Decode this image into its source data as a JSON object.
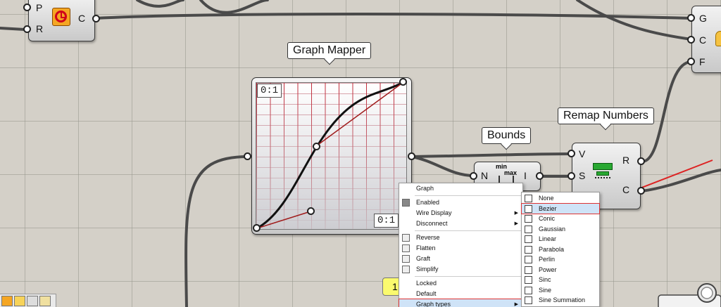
{
  "colors": {
    "canvas": "#d4d0c8",
    "wire": "#555555",
    "highlight_outline": "#dd3333",
    "arrow": "#dd2222",
    "menu_highlight": "#cfe3f7",
    "graph_grid": "#c22b3a"
  },
  "clock_node": {
    "inputs": [
      "P",
      "R"
    ],
    "output": "C",
    "icon": "clock-icon"
  },
  "right_node": {
    "outputs": [
      "G",
      "C",
      "F"
    ]
  },
  "graph_mapper": {
    "title": "Graph Mapper",
    "top_label": "0:1",
    "bottom_label": "0:1"
  },
  "bounds": {
    "title": "Bounds",
    "input": "N",
    "output": "I",
    "icon_top": "min",
    "icon_bottom": "max"
  },
  "remap": {
    "title": "Remap Numbers",
    "inputs": [
      "V",
      "S"
    ],
    "outputs": [
      "R",
      "C"
    ]
  },
  "panel_value": "1",
  "context_menu": {
    "items": [
      {
        "label": "Graph",
        "icon": "",
        "submenu": false
      },
      {
        "label": "Enabled",
        "icon": "enabled-icon",
        "submenu": false
      },
      {
        "label": "Wire Display",
        "icon": "",
        "submenu": true
      },
      {
        "label": "Disconnect",
        "icon": "",
        "submenu": true
      },
      {
        "label": "Reverse",
        "icon": "reverse-icon",
        "submenu": false
      },
      {
        "label": "Flatten",
        "icon": "flatten-icon",
        "submenu": false
      },
      {
        "label": "Graft",
        "icon": "graft-icon",
        "submenu": false
      },
      {
        "label": "Simplify",
        "icon": "simplify-icon",
        "submenu": false
      },
      {
        "label": "Locked",
        "icon": "",
        "submenu": false
      },
      {
        "label": "Default",
        "icon": "",
        "submenu": false
      },
      {
        "label": "Graph types",
        "icon": "",
        "submenu": true
      }
    ],
    "arrow_glyph": "▶"
  },
  "graph_types_menu": {
    "items": [
      {
        "label": "None",
        "icon": "none-graph-icon"
      },
      {
        "label": "Bezier",
        "icon": "bezier-graph-icon"
      },
      {
        "label": "Conic",
        "icon": "conic-graph-icon"
      },
      {
        "label": "Gaussian",
        "icon": "gaussian-graph-icon"
      },
      {
        "label": "Linear",
        "icon": "linear-graph-icon"
      },
      {
        "label": "Parabola",
        "icon": "parabola-graph-icon"
      },
      {
        "label": "Perlin",
        "icon": "perlin-graph-icon"
      },
      {
        "label": "Power",
        "icon": "power-graph-icon"
      },
      {
        "label": "Sinc",
        "icon": "sinc-graph-icon"
      },
      {
        "label": "Sine",
        "icon": "sine-graph-icon"
      },
      {
        "label": "Sine Summation",
        "icon": "sine-summation-graph-icon"
      }
    ],
    "selected": "Bezier"
  }
}
